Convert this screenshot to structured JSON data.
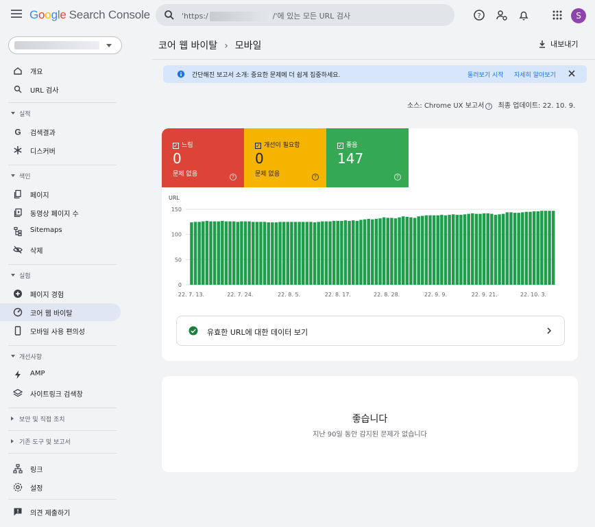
{
  "header": {
    "logo_google": [
      "G",
      "o",
      "o",
      "g",
      "l",
      "e"
    ],
    "logo_rest": "Search Console",
    "search_prefix": "'https:/",
    "search_suffix": "/'에 있는 모든 URL 검사",
    "avatar_letter": "S"
  },
  "sidebar": {
    "items_top": [
      {
        "label": "개요",
        "icon": "home-icon"
      },
      {
        "label": "URL 검사",
        "icon": "search-icon"
      }
    ],
    "sections": [
      {
        "title": "실적",
        "expanded": true,
        "items": [
          {
            "label": "검색결과",
            "icon": "google-g-icon"
          },
          {
            "label": "디스커버",
            "icon": "asterisk-icon"
          }
        ]
      },
      {
        "title": "색인",
        "expanded": true,
        "items": [
          {
            "label": "페이지",
            "icon": "pages-icon"
          },
          {
            "label": "동영상 페이지 수",
            "icon": "video-pages-icon"
          },
          {
            "label": "Sitemaps",
            "icon": "sitemap-icon"
          },
          {
            "label": "삭제",
            "icon": "eye-off-icon"
          }
        ]
      },
      {
        "title": "실험",
        "expanded": true,
        "items": [
          {
            "label": "페이지 경험",
            "icon": "plus-circle-icon"
          },
          {
            "label": "코어 웹 바이탈",
            "icon": "gauge-icon",
            "active": true
          },
          {
            "label": "모바일 사용 편의성",
            "icon": "phone-icon"
          }
        ]
      },
      {
        "title": "개선사항",
        "expanded": true,
        "items": [
          {
            "label": "AMP",
            "icon": "bolt-icon"
          },
          {
            "label": "사이트링크 검색창",
            "icon": "layers-icon"
          }
        ]
      },
      {
        "title": "보안 및 직접 조치",
        "expanded": false,
        "items": []
      },
      {
        "title": "기존 도구 및 보고서",
        "expanded": false,
        "items": []
      }
    ],
    "items_bottom": [
      {
        "label": "링크",
        "icon": "links-icon"
      },
      {
        "label": "설정",
        "icon": "settings-icon"
      }
    ],
    "feedback": {
      "label": "의견 제출하기",
      "icon": "feedback-icon"
    }
  },
  "main": {
    "breadcrumb": [
      "코어 웹 바이탈",
      "모바일"
    ],
    "export_label": "내보내기",
    "banner": {
      "text": "간단해진 보고서 소개: 중요한 문제에 더 쉽게 집중하세요.",
      "link_tour": "둘러보기 시작",
      "link_learn": "자세히 알아보기"
    },
    "source_label": "소스: Chrome UX 보고서",
    "updated_label": "최종 업데이트: 22. 10. 9.",
    "tiles": [
      {
        "label": "느림",
        "count": "0",
        "sub": "문제 없음",
        "color": "#db4437",
        "text_color": "#ffffff"
      },
      {
        "label": "개선이 필요함",
        "count": "0",
        "sub": "문제 없음",
        "color": "#f4b400",
        "text_color": "#202124"
      },
      {
        "label": "좋음",
        "count": "147",
        "sub": "",
        "color": "#34a853",
        "text_color": "#ffffff"
      }
    ],
    "valid_url_label": "유효한 URL에 대한 데이터 보기",
    "empty_title": "좋습니다",
    "empty_sub": "지난 90일 동안 감지된 문제가 없습니다"
  },
  "colors": {
    "bar_green": "#1e9e4a",
    "accent_blue": "#1a73e8"
  },
  "chart_data": {
    "type": "bar",
    "ylabel": "URL",
    "ylim": [
      0,
      150
    ],
    "yticks": [
      0,
      50,
      100,
      150
    ],
    "xtick_labels": [
      "22. 7. 13.",
      "22. 7. 24.",
      "22. 8. 5.",
      "22. 8. 17.",
      "22. 8. 28.",
      "22. 9. 9.",
      "22. 9. 21.",
      "22. 10. 3."
    ],
    "gap_after_index": 20,
    "series": [
      {
        "values": [
          0,
          124,
          125,
          125,
          126,
          127,
          126,
          126,
          126,
          127,
          126,
          126,
          126,
          125,
          126,
          126,
          126,
          125,
          125,
          125,
          125,
          124,
          124,
          124,
          125,
          125,
          125,
          125,
          125,
          125,
          125,
          125,
          125,
          124,
          125,
          126,
          126,
          126,
          127,
          127,
          127,
          128,
          127,
          128,
          127,
          129,
          130,
          131,
          130,
          131,
          132,
          134,
          133,
          133,
          132,
          134,
          136,
          135,
          134,
          133,
          136,
          137,
          138,
          138,
          138,
          138,
          139,
          138,
          139,
          140,
          139,
          139,
          140,
          141,
          142,
          141,
          141,
          142,
          142,
          141,
          139,
          140,
          141,
          144,
          144,
          143,
          143,
          144,
          145,
          145,
          146,
          146,
          147,
          147,
          147,
          147
        ]
      }
    ]
  }
}
